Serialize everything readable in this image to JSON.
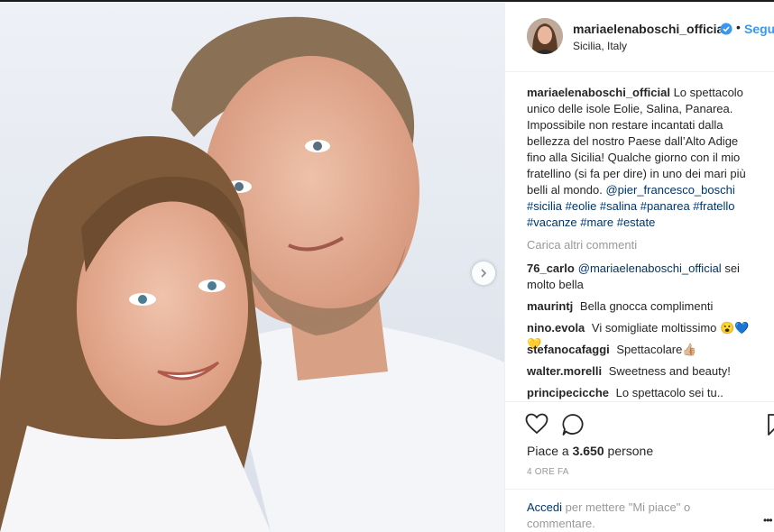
{
  "post": {
    "username": "mariaelenaboschi_official",
    "follow_label": "Segui",
    "bullet": "•",
    "location": "Sicilia, Italy",
    "caption": {
      "username": "mariaelenaboschi_official",
      "text": "Lo spettacolo unico delle isole Eolie, Salina, Panarea. Impossibile non restare incantati dalla bellezza del nostro Paese dall’Alto Adige fino alla Sicilia! Qualche giorno con il mio fratellino (si fa per dire) in uno dei mari più belli al mondo.",
      "mention": "@pier_francesco_boschi",
      "hashtags": "#sicilia #eolie #salina #panarea #fratello #vacanze #mare #estate"
    },
    "load_more": "Carica altri commenti",
    "comments": [
      {
        "username": "76_carlo",
        "mention": "@mariaelenaboschi_official",
        "text": "sei molto bella"
      },
      {
        "username": "maurintj",
        "text": "Bella gnocca complimenti"
      },
      {
        "username": "nino.evola",
        "text": "Vi somigliate moltissimo 😮💙💛"
      },
      {
        "username": "stefanocafaggi",
        "text": "Spettacolare👍🏼"
      },
      {
        "username": "walter.morelli",
        "text": "Sweetness and beauty!"
      },
      {
        "username": "principecicche",
        "text": "Lo spettacolo sei tu.."
      }
    ],
    "likes_prefix": "Piace a",
    "likes_count": "3.650",
    "likes_suffix": "persone",
    "time_ago": "4 ORE FA",
    "login_link": "Accedi",
    "login_text": "per mettere \"Mi piace\" o commentare.",
    "more_dots": "•••"
  },
  "colors": {
    "link": "#003569",
    "accent": "#3897f0",
    "muted": "#999999",
    "text": "#262626"
  },
  "icons": [
    "heart-icon",
    "comment-icon",
    "bookmark-icon",
    "verified-badge-icon",
    "chevron-right-icon"
  ]
}
